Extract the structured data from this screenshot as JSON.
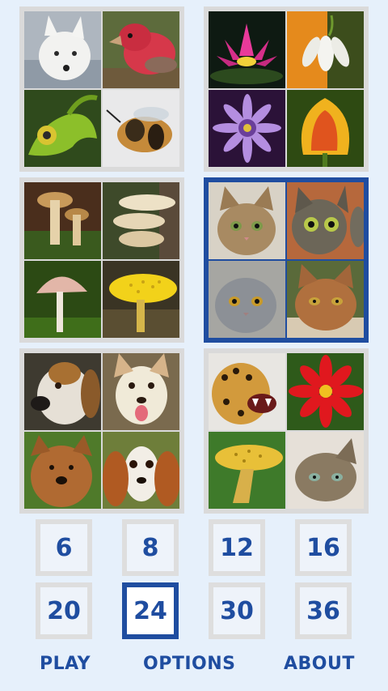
{
  "image_sets": [
    {
      "id": "wildlife",
      "selected": false,
      "tiles": [
        "arctic-fox",
        "house-finch",
        "chameleon",
        "bee"
      ]
    },
    {
      "id": "flowers",
      "selected": false,
      "tiles": [
        "water-lily",
        "snowdrop",
        "daisy",
        "tulip"
      ]
    },
    {
      "id": "mushrooms",
      "selected": false,
      "tiles": [
        "brown-mushrooms",
        "oyster-mushroom",
        "pink-mushroom",
        "yellow-mushroom"
      ]
    },
    {
      "id": "cats",
      "selected": true,
      "tiles": [
        "tabby-kitten",
        "peeking-cat",
        "gray-cat",
        "ginger-cat"
      ]
    },
    {
      "id": "dogs",
      "selected": false,
      "tiles": [
        "beagle",
        "white-dog",
        "terrier",
        "spaniel"
      ]
    },
    {
      "id": "mixed",
      "selected": false,
      "tiles": [
        "jaguar",
        "red-dahlia",
        "yellow-mushroom",
        "tabby-cat"
      ]
    }
  ],
  "card_counts": {
    "options": [
      "6",
      "8",
      "12",
      "16",
      "20",
      "24",
      "30",
      "36"
    ],
    "selected": "24"
  },
  "menu": {
    "play": "PLAY",
    "options": "OPTIONS",
    "about": "ABOUT"
  },
  "colors": {
    "background": "#e6f0fb",
    "accent": "#1f4da0",
    "frame": "#dadada"
  }
}
